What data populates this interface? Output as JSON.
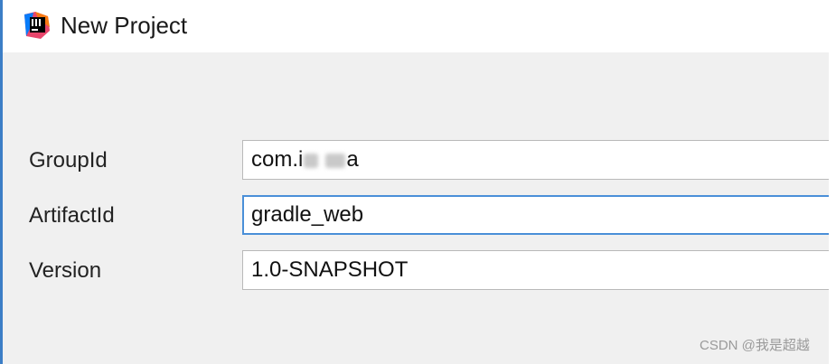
{
  "window": {
    "title": "New Project",
    "app_icon": "intellij-idea-icon"
  },
  "form": {
    "group_id": {
      "label": "GroupId",
      "value_prefix": "com.i",
      "value_suffix": "a",
      "value_obscured": true
    },
    "artifact_id": {
      "label": "ArtifactId",
      "value": "gradle_web"
    },
    "version": {
      "label": "Version",
      "value": "1.0-SNAPSHOT"
    }
  },
  "watermark": {
    "text": "CSDN @我是超越"
  },
  "colors": {
    "focus_border": "#4a8fd8",
    "window_border": "#3c7ec6",
    "dialog_background": "#f0f0f0"
  }
}
